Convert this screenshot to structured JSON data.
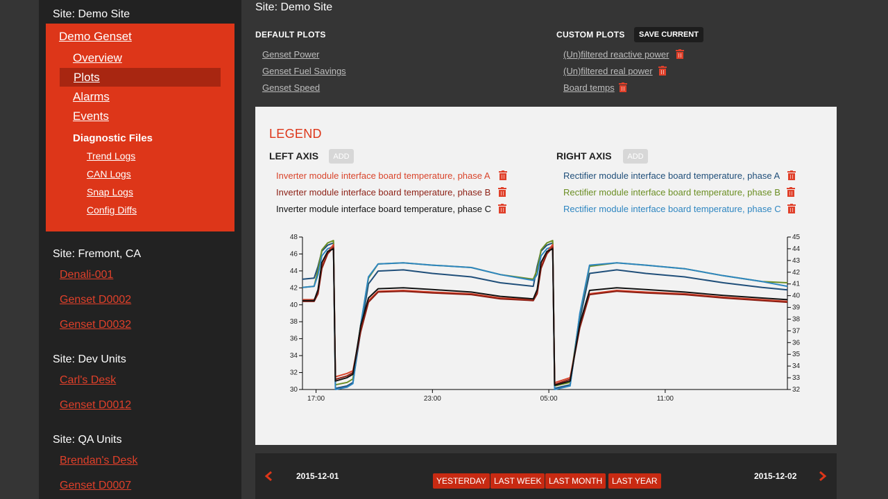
{
  "sidebar": {
    "sites": [
      {
        "title": "Site: Demo Site"
      },
      {
        "title": "Site: Fremont, CA",
        "units": [
          "Denali-001",
          "Genset D0002",
          "Genset D0032"
        ]
      },
      {
        "title": "Site: Dev Units",
        "units": [
          "Carl's Desk",
          "Genset D0012"
        ]
      },
      {
        "title": "Site: QA Units",
        "units": [
          "Brendan's Desk",
          "Genset D0007"
        ]
      }
    ],
    "active_unit": {
      "name": "Demo Genset",
      "nav": [
        "Overview",
        "Plots",
        "Alarms",
        "Events"
      ],
      "selected": "Plots",
      "diagnostics_heading": "Diagnostic Files",
      "diagnostics": [
        "Trend Logs",
        "CAN Logs",
        "Snap Logs",
        "Config Diffs"
      ]
    }
  },
  "main": {
    "title": "Site: Demo Site",
    "default_plots_label": "DEFAULT PLOTS",
    "default_plots": [
      "Genset Power",
      "Genset Fuel Savings",
      "Genset Speed"
    ],
    "custom_plots_label": "CUSTOM PLOTS",
    "save_current_label": "SAVE CURRENT",
    "custom_plots": [
      "(Un)filtered reactive power",
      "(Un)filtered real power",
      "Board temps"
    ]
  },
  "legend": {
    "title": "LEGEND",
    "left_axis_label": "LEFT AXIS",
    "right_axis_label": "RIGHT AXIS",
    "add_label": "ADD",
    "left_series": [
      {
        "name": "Inverter module interface board temperature, phase A",
        "color": "#d9442b"
      },
      {
        "name": "Inverter module interface board temperature, phase B",
        "color": "#8c1f14"
      },
      {
        "name": "Inverter module interface board temperature, phase C",
        "color": "#111111"
      }
    ],
    "right_series": [
      {
        "name": "Rectifier module interface board temperature, phase A",
        "color": "#1f4e79"
      },
      {
        "name": "Rectifier module interface board temperature, phase B",
        "color": "#6b8e23"
      },
      {
        "name": "Rectifier module interface board temperature, phase C",
        "color": "#2e86c1"
      }
    ],
    "trash_color": "#e0402a"
  },
  "chart_data": {
    "type": "line",
    "x_ticks": [
      "17:00",
      "23:00",
      "05:00",
      "11:00"
    ],
    "left_yticks": [
      30,
      32,
      34,
      36,
      38,
      40,
      42,
      44,
      46,
      48
    ],
    "right_yticks": [
      32,
      33,
      34,
      35,
      36,
      37,
      38,
      39,
      40,
      41,
      42,
      43,
      44,
      45
    ],
    "left_ylim": [
      30,
      48
    ],
    "right_ylim": [
      32,
      45
    ],
    "x_range_hours": [
      16.3,
      41.3
    ],
    "x_tick_hours": [
      17,
      23,
      29,
      35
    ],
    "series": [
      {
        "name": "Inverter module interface board temperature, phase A",
        "axis": "left",
        "color": "#d9442b",
        "points": [
          [
            16.3,
            40.6
          ],
          [
            16.9,
            40.6
          ],
          [
            17.1,
            41.5
          ],
          [
            17.3,
            44.5
          ],
          [
            17.6,
            46.2
          ],
          [
            17.9,
            47.1
          ],
          [
            18.0,
            31.5
          ],
          [
            18.6,
            31.9
          ],
          [
            18.9,
            32.2
          ],
          [
            19.3,
            37.0
          ],
          [
            19.7,
            40.5
          ],
          [
            20.2,
            41.6
          ],
          [
            21.5,
            41.7
          ],
          [
            23.0,
            41.5
          ],
          [
            25.0,
            41.3
          ],
          [
            26.5,
            40.8
          ],
          [
            28.2,
            40.6
          ],
          [
            28.4,
            41.5
          ],
          [
            28.6,
            44.5
          ],
          [
            28.9,
            46.2
          ],
          [
            29.2,
            47.1
          ],
          [
            29.3,
            30.8
          ],
          [
            30.1,
            31.4
          ],
          [
            30.6,
            37.5
          ],
          [
            31.1,
            41.3
          ],
          [
            32.5,
            41.7
          ],
          [
            34.0,
            41.5
          ],
          [
            36.0,
            41.3
          ],
          [
            38.0,
            40.9
          ],
          [
            40.0,
            40.6
          ],
          [
            41.3,
            40.4
          ]
        ]
      },
      {
        "name": "Inverter module interface board temperature, phase B",
        "axis": "left",
        "color": "#8c1f14",
        "points": [
          [
            16.3,
            40.4
          ],
          [
            16.9,
            40.4
          ],
          [
            17.1,
            41.3
          ],
          [
            17.3,
            44.3
          ],
          [
            17.6,
            46.0
          ],
          [
            17.9,
            46.8
          ],
          [
            18.0,
            31.2
          ],
          [
            18.6,
            31.6
          ],
          [
            18.9,
            32.0
          ],
          [
            19.3,
            36.8
          ],
          [
            19.7,
            40.3
          ],
          [
            20.2,
            41.5
          ],
          [
            21.5,
            41.6
          ],
          [
            23.0,
            41.4
          ],
          [
            25.0,
            41.2
          ],
          [
            26.5,
            40.7
          ],
          [
            28.2,
            40.5
          ],
          [
            28.4,
            41.3
          ],
          [
            28.6,
            44.3
          ],
          [
            28.9,
            46.0
          ],
          [
            29.2,
            46.8
          ],
          [
            29.3,
            30.6
          ],
          [
            30.1,
            31.2
          ],
          [
            30.6,
            37.3
          ],
          [
            31.1,
            41.2
          ],
          [
            32.5,
            41.6
          ],
          [
            34.0,
            41.4
          ],
          [
            36.0,
            41.2
          ],
          [
            38.0,
            40.8
          ],
          [
            40.0,
            40.5
          ],
          [
            41.3,
            40.3
          ]
        ]
      },
      {
        "name": "Inverter module interface board temperature, phase C",
        "axis": "left",
        "color": "#111111",
        "points": [
          [
            16.3,
            40.5
          ],
          [
            16.9,
            40.5
          ],
          [
            17.1,
            41.8
          ],
          [
            17.3,
            45.0
          ],
          [
            17.6,
            46.3
          ],
          [
            17.9,
            46.6
          ],
          [
            18.0,
            31.0
          ],
          [
            18.6,
            31.4
          ],
          [
            18.9,
            31.8
          ],
          [
            19.3,
            37.5
          ],
          [
            19.7,
            40.8
          ],
          [
            20.2,
            41.9
          ],
          [
            21.5,
            42.0
          ],
          [
            23.0,
            41.8
          ],
          [
            25.0,
            41.5
          ],
          [
            26.5,
            41.0
          ],
          [
            28.2,
            40.7
          ],
          [
            28.4,
            41.8
          ],
          [
            28.6,
            45.0
          ],
          [
            28.9,
            46.3
          ],
          [
            29.2,
            46.6
          ],
          [
            29.3,
            30.5
          ],
          [
            30.1,
            31.0
          ],
          [
            30.6,
            37.8
          ],
          [
            31.1,
            41.7
          ],
          [
            32.5,
            42.0
          ],
          [
            34.0,
            41.8
          ],
          [
            36.0,
            41.5
          ],
          [
            38.0,
            41.1
          ],
          [
            40.0,
            40.8
          ],
          [
            41.3,
            40.6
          ]
        ]
      },
      {
        "name": "Rectifier module interface board temperature, phase A",
        "axis": "right",
        "color": "#1f4e79",
        "points": [
          [
            16.3,
            41.4
          ],
          [
            16.9,
            41.5
          ],
          [
            17.1,
            42.5
          ],
          [
            17.3,
            43.8
          ],
          [
            17.6,
            44.3
          ],
          [
            17.9,
            44.5
          ],
          [
            18.0,
            32.1
          ],
          [
            18.6,
            32.3
          ],
          [
            18.9,
            32.6
          ],
          [
            19.3,
            37.0
          ],
          [
            19.7,
            41.0
          ],
          [
            20.2,
            42.1
          ],
          [
            21.5,
            42.2
          ],
          [
            23.0,
            41.9
          ],
          [
            25.0,
            41.6
          ],
          [
            26.5,
            41.1
          ],
          [
            28.2,
            40.8
          ],
          [
            28.4,
            42.5
          ],
          [
            28.6,
            43.8
          ],
          [
            28.9,
            44.3
          ],
          [
            29.2,
            44.5
          ],
          [
            29.3,
            32.1
          ],
          [
            30.1,
            32.4
          ],
          [
            30.6,
            38.0
          ],
          [
            31.1,
            41.9
          ],
          [
            32.5,
            42.2
          ],
          [
            34.0,
            41.9
          ],
          [
            36.0,
            41.6
          ],
          [
            38.0,
            41.1
          ],
          [
            40.0,
            40.7
          ],
          [
            41.3,
            40.5
          ]
        ]
      },
      {
        "name": "Rectifier module interface board temperature, phase B",
        "axis": "right",
        "color": "#6b8e23",
        "points": [
          [
            16.3,
            40.7
          ],
          [
            16.9,
            40.8
          ],
          [
            17.1,
            42.2
          ],
          [
            17.3,
            43.9
          ],
          [
            17.6,
            44.5
          ],
          [
            17.9,
            44.7
          ],
          [
            18.0,
            32.4
          ],
          [
            18.6,
            32.6
          ],
          [
            18.9,
            32.9
          ],
          [
            19.3,
            37.5
          ],
          [
            19.7,
            41.5
          ],
          [
            20.2,
            42.7
          ],
          [
            21.5,
            42.8
          ],
          [
            23.0,
            42.6
          ],
          [
            25.0,
            42.4
          ],
          [
            26.5,
            41.8
          ],
          [
            28.2,
            41.4
          ],
          [
            28.4,
            42.2
          ],
          [
            28.6,
            43.9
          ],
          [
            28.9,
            44.5
          ],
          [
            29.2,
            44.7
          ],
          [
            29.3,
            32.3
          ],
          [
            30.1,
            32.6
          ],
          [
            30.6,
            38.4
          ],
          [
            31.1,
            42.5
          ],
          [
            32.5,
            42.8
          ],
          [
            34.0,
            42.6
          ],
          [
            36.0,
            42.3
          ],
          [
            38.0,
            41.7
          ],
          [
            40.0,
            41.2
          ],
          [
            41.3,
            41.1
          ]
        ]
      },
      {
        "name": "Rectifier module interface board temperature, phase C",
        "axis": "right",
        "color": "#2e86c1",
        "points": [
          [
            16.3,
            40.7
          ],
          [
            16.9,
            40.8
          ],
          [
            17.1,
            41.8
          ],
          [
            17.3,
            43.4
          ],
          [
            17.6,
            44.0
          ],
          [
            17.9,
            44.2
          ],
          [
            18.0,
            32.0
          ],
          [
            18.6,
            32.2
          ],
          [
            18.9,
            32.5
          ],
          [
            19.3,
            37.5
          ],
          [
            19.7,
            41.6
          ],
          [
            20.2,
            42.7
          ],
          [
            21.5,
            42.8
          ],
          [
            23.0,
            42.6
          ],
          [
            25.0,
            42.4
          ],
          [
            26.5,
            41.8
          ],
          [
            28.2,
            41.3
          ],
          [
            28.4,
            41.8
          ],
          [
            28.6,
            43.4
          ],
          [
            28.9,
            44.0
          ],
          [
            29.2,
            44.2
          ],
          [
            29.3,
            32.0
          ],
          [
            30.1,
            32.3
          ],
          [
            30.6,
            38.5
          ],
          [
            31.1,
            42.6
          ],
          [
            32.5,
            42.8
          ],
          [
            34.0,
            42.6
          ],
          [
            36.0,
            42.3
          ],
          [
            38.0,
            41.7
          ],
          [
            40.0,
            41.2
          ],
          [
            41.3,
            40.8
          ]
        ]
      }
    ]
  },
  "footer": {
    "start_date": "2015-12-01",
    "end_date": "2015-12-02",
    "ranges": [
      "YESTERDAY",
      "LAST WEEK",
      "LAST MONTH",
      "LAST YEAR"
    ],
    "accent": "#dd3619"
  }
}
